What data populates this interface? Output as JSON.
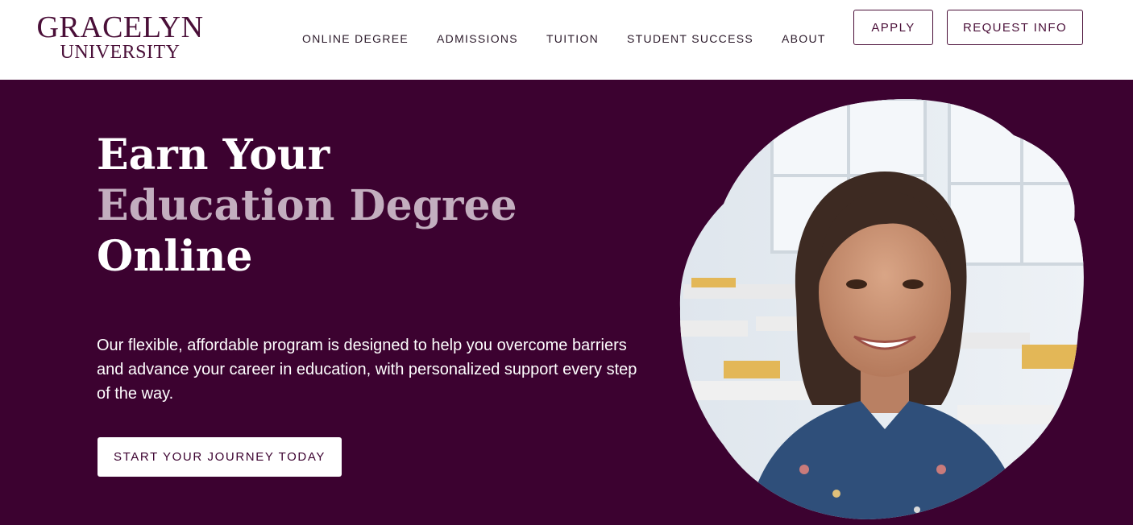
{
  "header": {
    "logo_line1": "GRACELYN",
    "logo_line2": "UNIVERSITY",
    "nav": [
      {
        "label": "ONLINE DEGREE"
      },
      {
        "label": "ADMISSIONS"
      },
      {
        "label": "TUITION"
      },
      {
        "label": "STUDENT SUCCESS"
      },
      {
        "label": "ABOUT"
      }
    ],
    "apply_label": "APPLY",
    "request_info_label": "REQUEST INFO"
  },
  "hero": {
    "headline_line1": "Earn Your",
    "headline_line2": "Education Degree",
    "headline_line3": "Online",
    "body": "Our flexible, affordable program is designed to help you overcome barriers and advance your career in education, with personalized support every step of the way.",
    "cta_label": "START YOUR JOURNEY TODAY"
  },
  "colors": {
    "brand": "#4a0f38",
    "hero_background": "#3c0230",
    "headline_accent": "#c3aebf"
  }
}
